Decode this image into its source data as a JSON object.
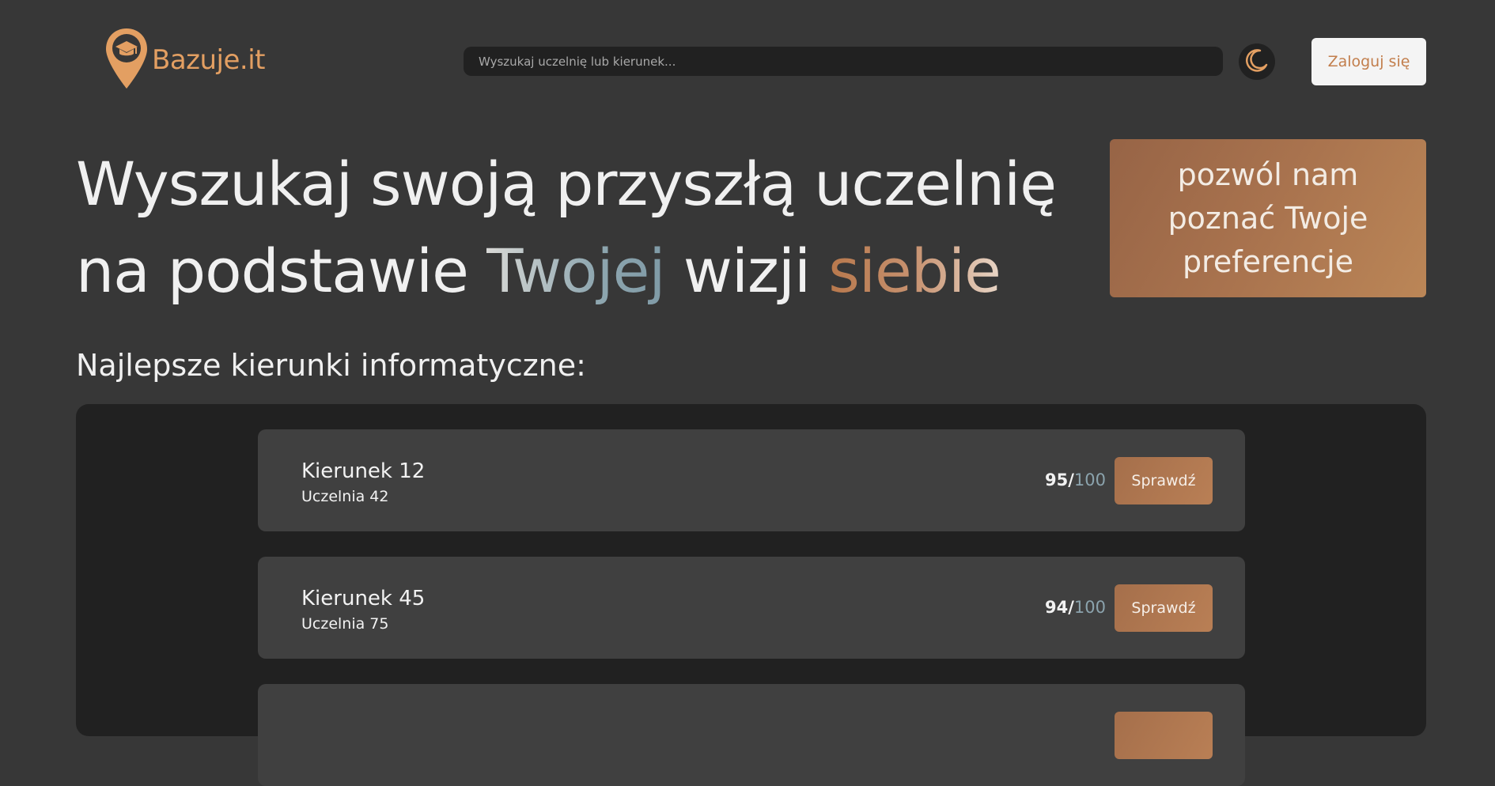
{
  "header": {
    "logo_text": "Bazuje.it",
    "search_placeholder": "Wyszukaj uczelnię lub kierunek...",
    "theme_toggle_icon": "moon-icon",
    "login_label": "Zaloguj się"
  },
  "hero": {
    "line1": "Wyszukaj swoją przyszłą uczelnię",
    "line2_part1": "na podstawie ",
    "line2_accent1": "Twojej",
    "line2_part2": " wizji ",
    "line2_accent2": "siebie",
    "preferences_cta": "pozwól nam poznać Twoje preferencje"
  },
  "section": {
    "title": "Najlepsze kierunki informatyczne:"
  },
  "courses": [
    {
      "name": "Kierunek 12",
      "university": "Uczelnia 42",
      "score": "95/",
      "score_max": "100",
      "button_label": "Sprawdź"
    },
    {
      "name": "Kierunek 45",
      "university": "Uczelnia 75",
      "score": "94/",
      "score_max": "100",
      "button_label": "Sprawdź"
    }
  ],
  "colors": {
    "background": "#373737",
    "panel": "#212121",
    "card": "#404040",
    "accent_copper": "#b97f55",
    "accent_blue": "#8ba3ad"
  }
}
